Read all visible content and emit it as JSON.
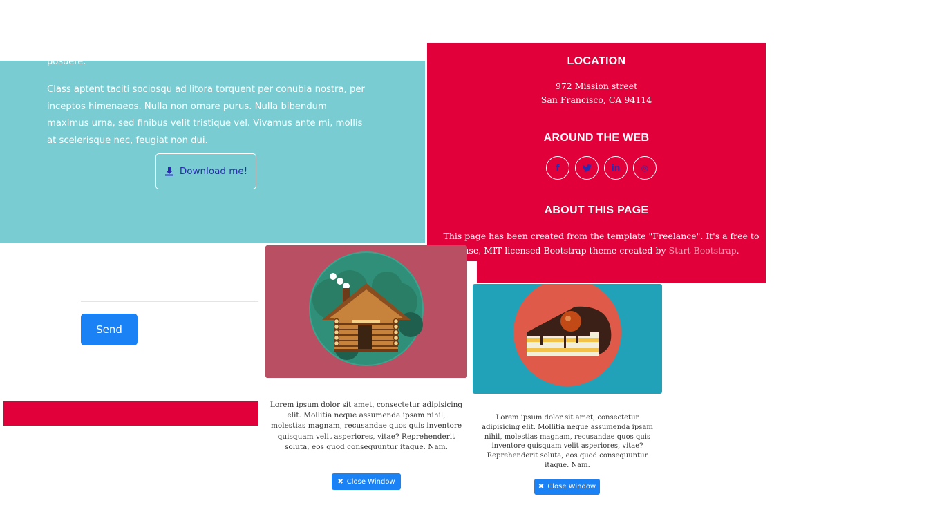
{
  "about": {
    "fragment": "posuere.",
    "paragraph": "Class aptent taciti sociosqu ad litora torquent per conubia nostra, per inceptos himenaeos. Nulla non ornare purus. Nulla bibendum maximus urna, sed finibus velit tristique vel. Vivamus ante mi, mollis at scelerisque nec, feugiat non dui.",
    "download_label": "Download me!",
    "download_icon": "download-icon"
  },
  "footer": {
    "location_heading": "LOCATION",
    "address_line1": "972 Mission street",
    "address_line2": "San Francisco, CA 94114",
    "web_heading": "AROUND THE WEB",
    "social": [
      {
        "icon": "facebook-icon",
        "glyph": "f"
      },
      {
        "icon": "twitter-icon",
        "glyph": "t"
      },
      {
        "icon": "linkedin-icon",
        "glyph": "in"
      },
      {
        "icon": "dribbble-icon",
        "glyph": "◎"
      }
    ],
    "about_heading": "ABOUT THIS PAGE",
    "about_text_before": "This page has been created from the template \"Freelance\". It's a free to use, MIT licensed Bootstrap theme created by ",
    "about_link": "Start Bootstrap",
    "about_text_after": "."
  },
  "contact": {
    "send_label": "Send"
  },
  "modals": [
    {
      "image": "cabin-illustration",
      "description": "Lorem ipsum dolor sit amet, consectetur adipisicing elit. Mollitia neque assumenda ipsam nihil, molestias magnam, recusandae quos quis inventore quisquam velit asperiores, vitae? Reprehenderit soluta, eos quod consequuntur itaque. Nam.",
      "close_label": "Close Window"
    },
    {
      "image": "cake-illustration",
      "description": "Lorem ipsum dolor sit amet, consectetur adipisicing elit. Mollitia neque assumenda ipsam nihil, molestias magnam, recusandae quos quis inventore quisquam velit asperiores, vitae? Reprehenderit soluta, eos quod consequuntur itaque. Nam.",
      "close_label": "Close Window"
    }
  ],
  "colors": {
    "teal": "#79cdd2",
    "crimson": "#e1003a",
    "button_blue": "#1a82f4",
    "link_pink": "#ff9bb3"
  }
}
